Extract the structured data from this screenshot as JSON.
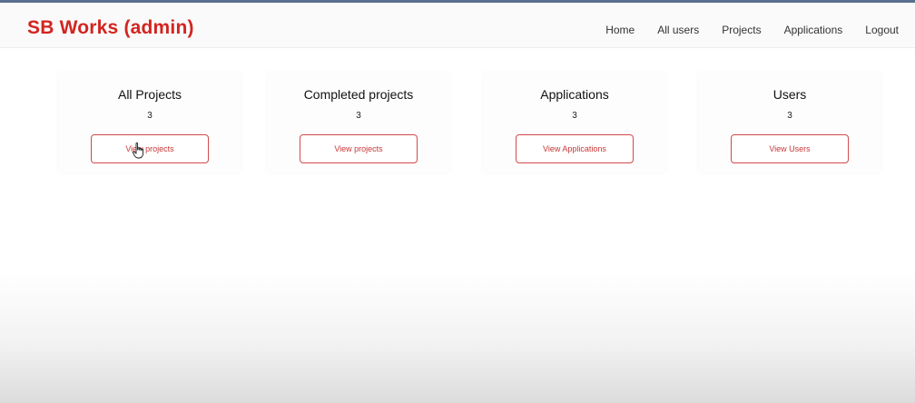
{
  "brand": {
    "title": "SB Works (admin)",
    "color": "#d3241f"
  },
  "nav": {
    "items": [
      "Home",
      "All users",
      "Projects",
      "Applications",
      "Logout"
    ]
  },
  "cards": [
    {
      "title": "All Projects",
      "count": "3",
      "button": "View projects"
    },
    {
      "title": "Completed projects",
      "count": "3",
      "button": "View projects"
    },
    {
      "title": "Applications",
      "count": "3",
      "button": "View Applications"
    },
    {
      "title": "Users",
      "count": "3",
      "button": "View Users"
    }
  ],
  "colors": {
    "accent": "#d14a4a",
    "top_rule": "#5a6f8e"
  },
  "cursor_icon": "hand-pointer-icon"
}
